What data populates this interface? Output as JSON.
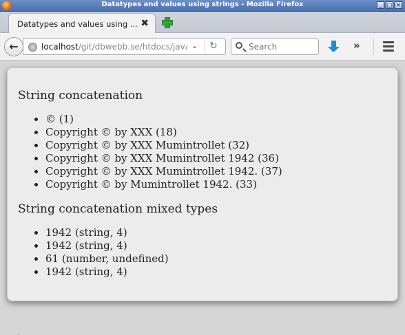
{
  "window": {
    "title": "Datatypes and values using strings - Mozilla Firefox",
    "buttons": {
      "minimize": "_",
      "maximize": "□",
      "close": "✕"
    }
  },
  "tabs": [
    {
      "label": "Datatypes and values using ...",
      "close": "✖"
    }
  ],
  "nav": {
    "back_glyph": "←",
    "url_host": "localhost",
    "url_path": "/git/dbwebb.se/htdocs/javas",
    "dropdown_glyph": "⌄",
    "reload_glyph": "↻",
    "search_placeholder": "Search",
    "overflow_glyph": "»"
  },
  "page": {
    "section1": {
      "heading": "String concatenation",
      "items": [
        "© (1)",
        "Copyright © by XXX (18)",
        "Copyright © by XXX Mumintrollet (32)",
        "Copyright © by XXX Mumintrollet 1942 (36)",
        "Copyright © by XXX Mumintrollet 1942. (37)",
        "Copyright © by Mumintrollet 1942. (33)"
      ]
    },
    "section2": {
      "heading": "String concatenation mixed types",
      "items": [
        "1942 (string, 4)",
        "1942 (string, 4)",
        "61 (number, undefined)",
        "1942 (string, 4)"
      ]
    }
  },
  "icons": {
    "app": "firefox-icon",
    "new_tab": "plus-icon",
    "site": "globe-icon",
    "search": "search-icon",
    "download": "download-arrow-icon",
    "menu": "hamburger-menu-icon"
  }
}
